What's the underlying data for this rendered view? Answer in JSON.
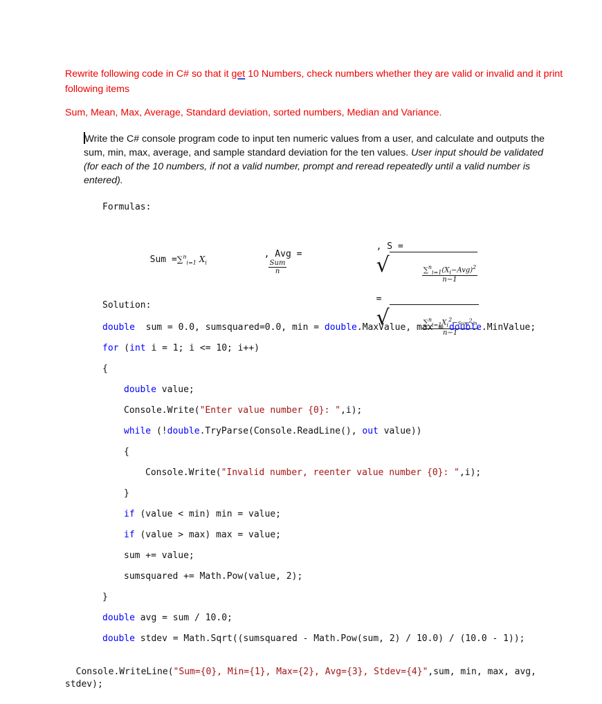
{
  "requirement": {
    "line1_before": "Rewrite following code in C# so that it ",
    "line1_spell": "get",
    "line1_after": " 10 Numbers, check numbers whether they are valid or invalid and it print following items",
    "line2": "Sum, Mean, Max, Average, Standard deviation, sorted numbers, Median and Variance."
  },
  "description": {
    "normal": "Write the C# console program code to input ten numeric values from a user, and calculate and outputs the sum, min, max, average, and sample standard deviation for the ten values. ",
    "italic": "User input should be validated (for each of the 10 numbers, if not a valid number, prompt and reread repeatedly until a valid number is entered)."
  },
  "formulas": {
    "heading": "Formulas:",
    "sum_label": "Sum =",
    "avg_label": ", Avg =",
    "s_label": ", S =",
    "avg_num": "Sum",
    "avg_den": "n",
    "s_den": "n−1",
    "equals": "="
  },
  "solution": {
    "heading": "Solution:",
    "lines": [
      {
        "indent": 0,
        "tokens": [
          [
            "kw",
            "double"
          ],
          [
            "",
            "  sum = 0.0, sumsquared=0.0, min = "
          ],
          [
            "kw",
            "double"
          ],
          [
            "",
            ".MaxValue, max = "
          ],
          [
            "kw",
            "double"
          ],
          [
            "",
            ".MinValue;"
          ]
        ]
      },
      {
        "indent": 0,
        "tokens": [
          [
            "kw",
            "for"
          ],
          [
            "",
            " ("
          ],
          [
            "kw",
            "int"
          ],
          [
            "",
            " i = 1; i <= 10; i++)"
          ]
        ]
      },
      {
        "indent": 0,
        "tokens": [
          [
            "",
            "{"
          ]
        ]
      },
      {
        "indent": 1,
        "tokens": [
          [
            "kw",
            "double"
          ],
          [
            "",
            " value;"
          ]
        ]
      },
      {
        "indent": 1,
        "tokens": [
          [
            "",
            "Console.Write("
          ],
          [
            "str",
            "\"Enter value number {0}: \""
          ],
          [
            "",
            ",i);"
          ]
        ]
      },
      {
        "indent": 1,
        "tokens": [
          [
            "kw",
            "while"
          ],
          [
            "",
            " (!"
          ],
          [
            "kw",
            "double"
          ],
          [
            "",
            ".TryParse(Console.ReadLine(), "
          ],
          [
            "kw",
            "out"
          ],
          [
            "",
            " value))"
          ]
        ]
      },
      {
        "indent": 1,
        "tokens": [
          [
            "",
            "{"
          ]
        ]
      },
      {
        "indent": 2,
        "tokens": [
          [
            "",
            "Console.Write("
          ],
          [
            "str",
            "\"Invalid number, reenter value number {0}: \""
          ],
          [
            "",
            ",i);"
          ]
        ]
      },
      {
        "indent": 1,
        "tokens": [
          [
            "",
            "}"
          ]
        ]
      },
      {
        "indent": 1,
        "tokens": [
          [
            "kw",
            "if"
          ],
          [
            "",
            " (value < min) min = value;"
          ]
        ]
      },
      {
        "indent": 1,
        "tokens": [
          [
            "kw",
            "if"
          ],
          [
            "",
            " (value > max) max = value;"
          ]
        ]
      },
      {
        "indent": 1,
        "tokens": [
          [
            "",
            "sum += value;"
          ]
        ]
      },
      {
        "indent": 1,
        "tokens": [
          [
            "",
            "sumsquared += Math.Pow(value, 2);"
          ]
        ]
      },
      {
        "indent": 0,
        "tokens": [
          [
            "",
            "}"
          ]
        ]
      },
      {
        "indent": 0,
        "tokens": [
          [
            "kw",
            "double"
          ],
          [
            "",
            " avg = sum / 10.0;"
          ]
        ]
      },
      {
        "indent": 0,
        "tokens": [
          [
            "kw",
            "double"
          ],
          [
            "",
            " stdev = Math.Sqrt((sumsquared - Math.Pow(sum, 2) / 10.0) / (10.0 - 1));"
          ]
        ]
      }
    ],
    "final_line": [
      [
        "",
        "Console.WriteLine("
      ],
      [
        "str",
        "\"Sum={0}, Min={1}, Max={2}, Avg={3}, Stdev={4}\""
      ],
      [
        "",
        ",sum, min, max, avg,"
      ]
    ],
    "final_line2": "stdev);"
  },
  "colors": {
    "requirement_text": "#ee0000",
    "keyword": "#0000ff",
    "string": "#a31515",
    "spellcheck_underline": "#2c4bd8"
  }
}
